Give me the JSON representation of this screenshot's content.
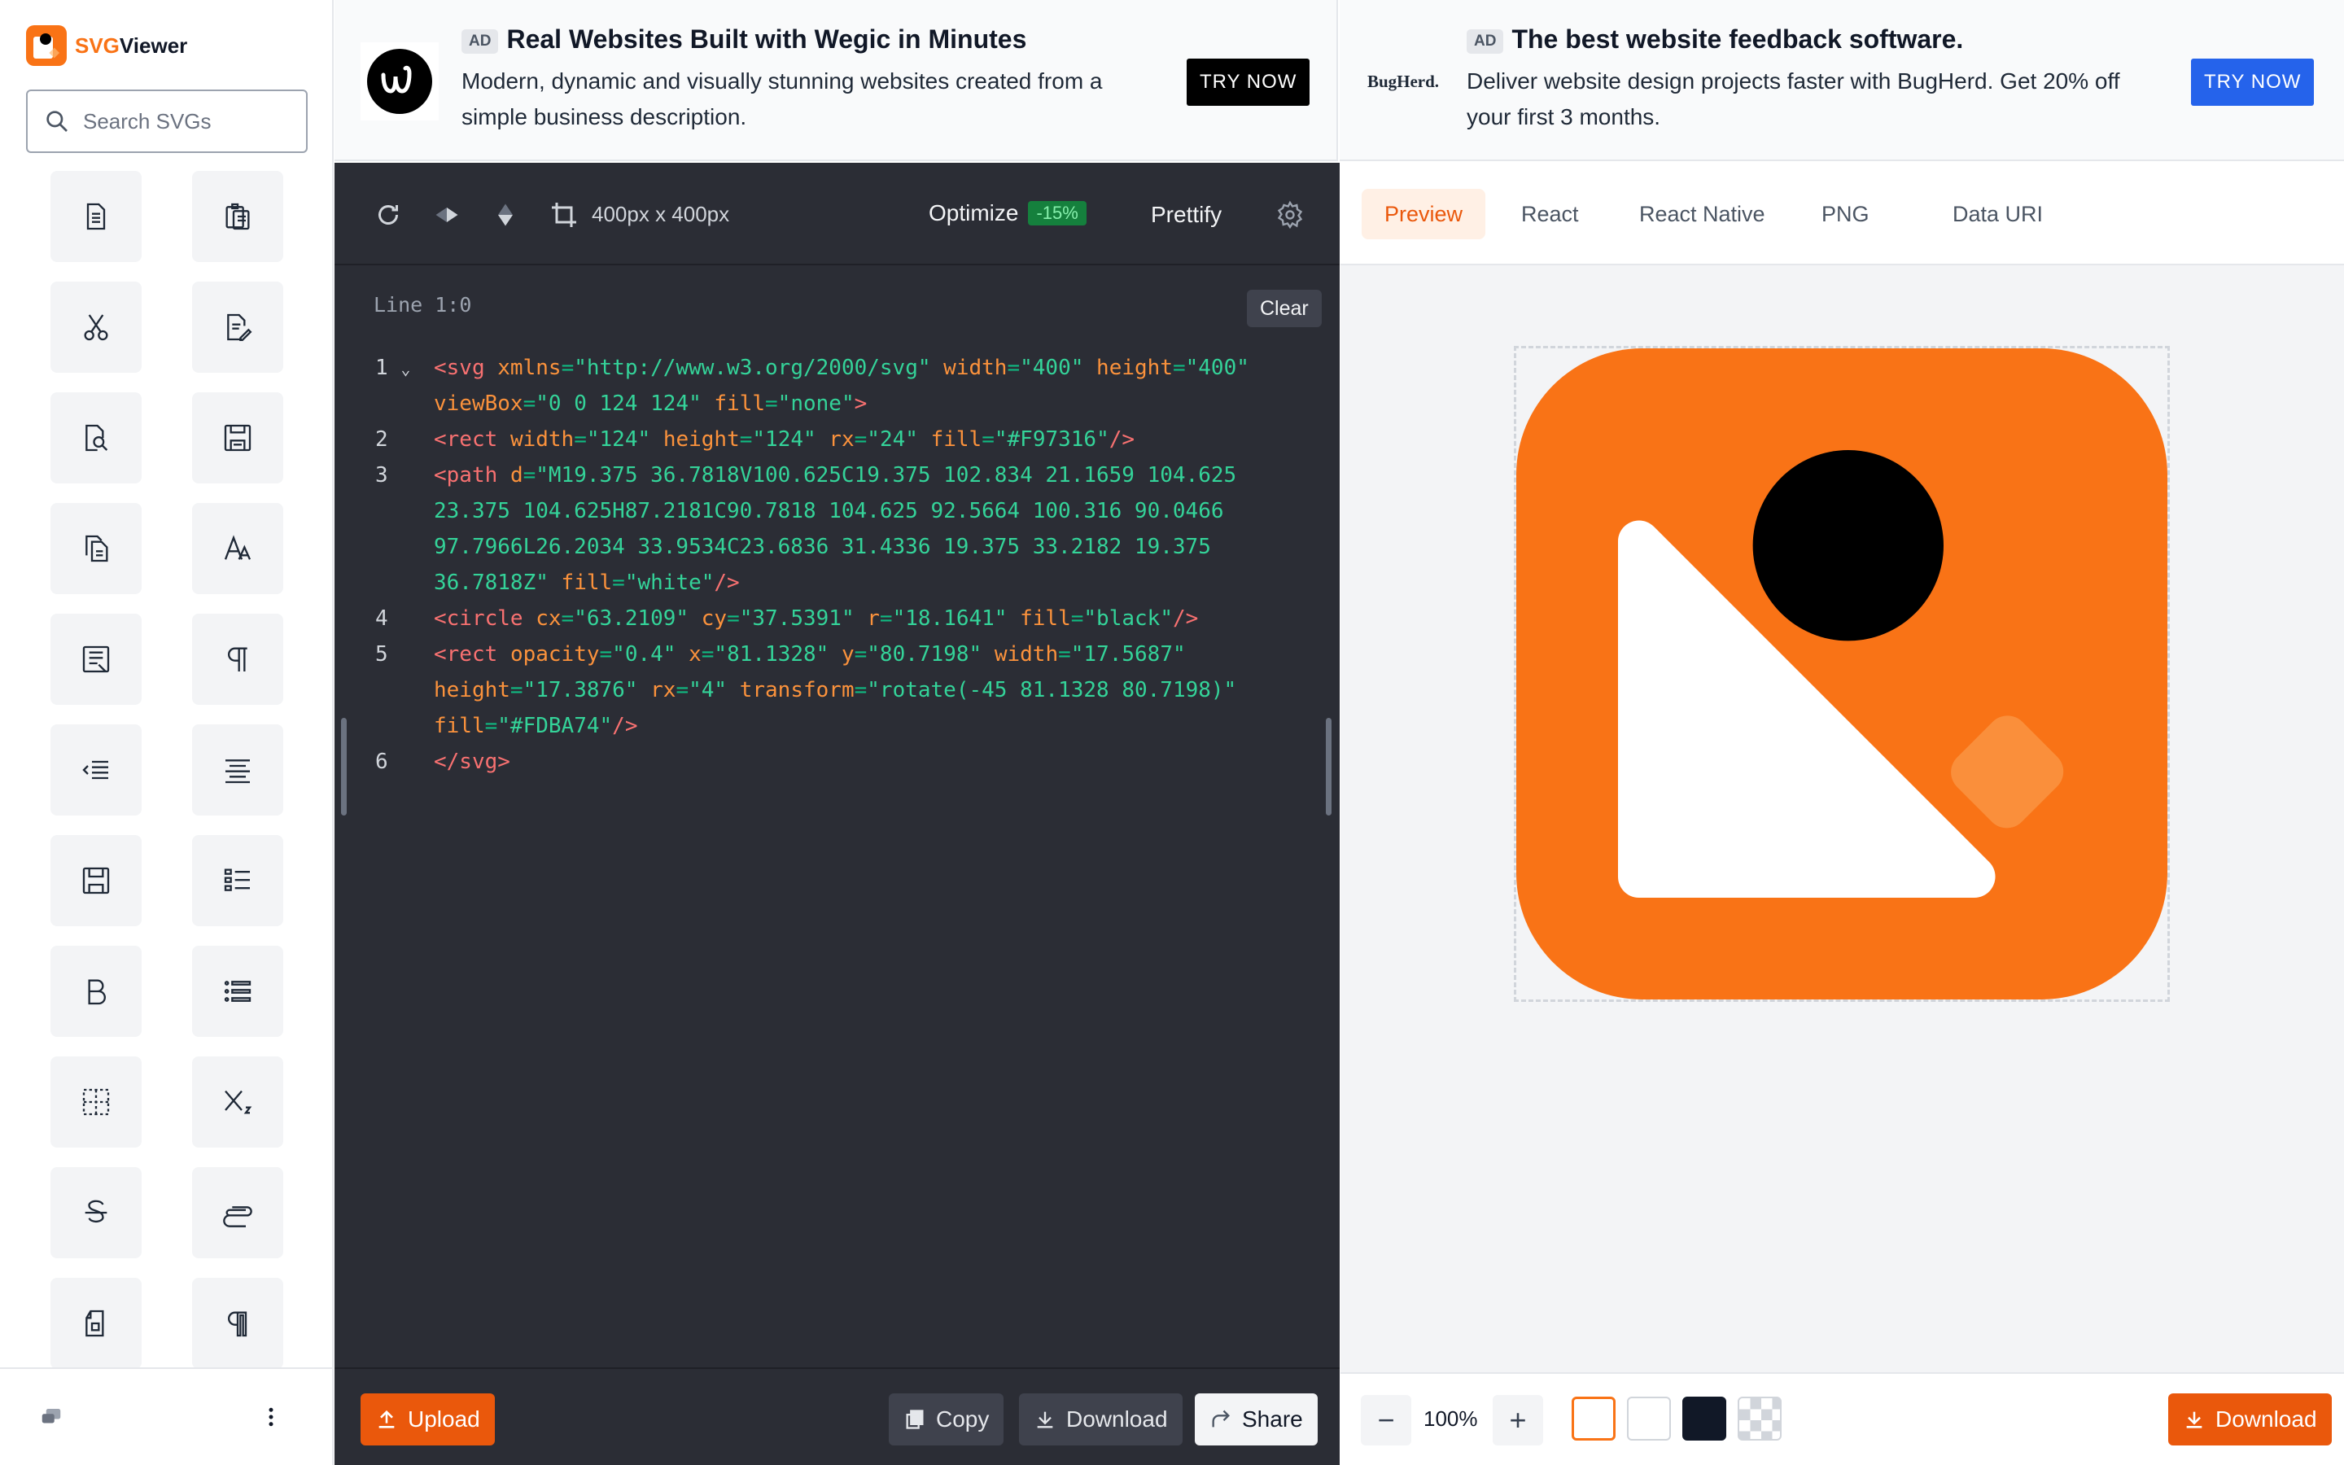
{
  "app": {
    "logo_prefix": "SVG",
    "logo_suffix": "Viewer"
  },
  "sidebar": {
    "search_placeholder": "Search SVGs",
    "icons": [
      "document-icon",
      "clipboard-document-icon",
      "scissors-icon",
      "document-edit-icon",
      "document-search-icon",
      "floppy-disk-icon",
      "documents-copy-icon",
      "font-size-icon",
      "form-document-icon",
      "pilcrow-icon",
      "indent-decrease-icon",
      "align-center-icon",
      "save-document-icon",
      "list-grid-icon",
      "bold-icon",
      "list-bulleted-icon",
      "table-dashed-icon",
      "subscript-icon",
      "strikethrough-icon",
      "paperclip-icon",
      "document-flip-icon",
      "pilcrow-outline-icon"
    ]
  },
  "ads": [
    {
      "badge": "AD",
      "title": "Real Websites Built with Wegic in Minutes",
      "description": "Modern, dynamic and visually stunning websites created from a simple business description.",
      "cta": "TRY NOW"
    },
    {
      "badge": "AD",
      "brand": "BugHerd.",
      "title": "The best website feedback software.",
      "description": "Deliver website design projects faster with BugHerd. Get 20% off your first 3 months.",
      "cta": "TRY NOW"
    }
  ],
  "editor": {
    "dimensions": "400px x 400px",
    "optimize_label": "Optimize",
    "optimize_badge": "-15%",
    "prettify_label": "Prettify",
    "line_info": "Line 1:0",
    "clear_label": "Clear",
    "code_lines": [
      "1",
      "2",
      "3",
      "4",
      "5",
      "6"
    ],
    "upload_label": "Upload",
    "copy_label": "Copy",
    "download_label": "Download",
    "share_label": "Share"
  },
  "preview": {
    "tabs": [
      "Preview",
      "React",
      "React Native",
      "PNG",
      "Data URI"
    ],
    "active_tab": "Preview",
    "zoom": "100%",
    "download_label": "Download",
    "svg": {
      "bg_fill": "#F97316",
      "circle_fill": "black",
      "path_fill": "white",
      "accent_fill": "#FDBA74"
    },
    "swatches": [
      "#ffffff",
      "#ffffff",
      "#111827",
      "checker"
    ]
  },
  "colors": {
    "accent": "#ea580c",
    "editor_bg": "#2b2d35",
    "brand_blue": "#2563eb"
  }
}
